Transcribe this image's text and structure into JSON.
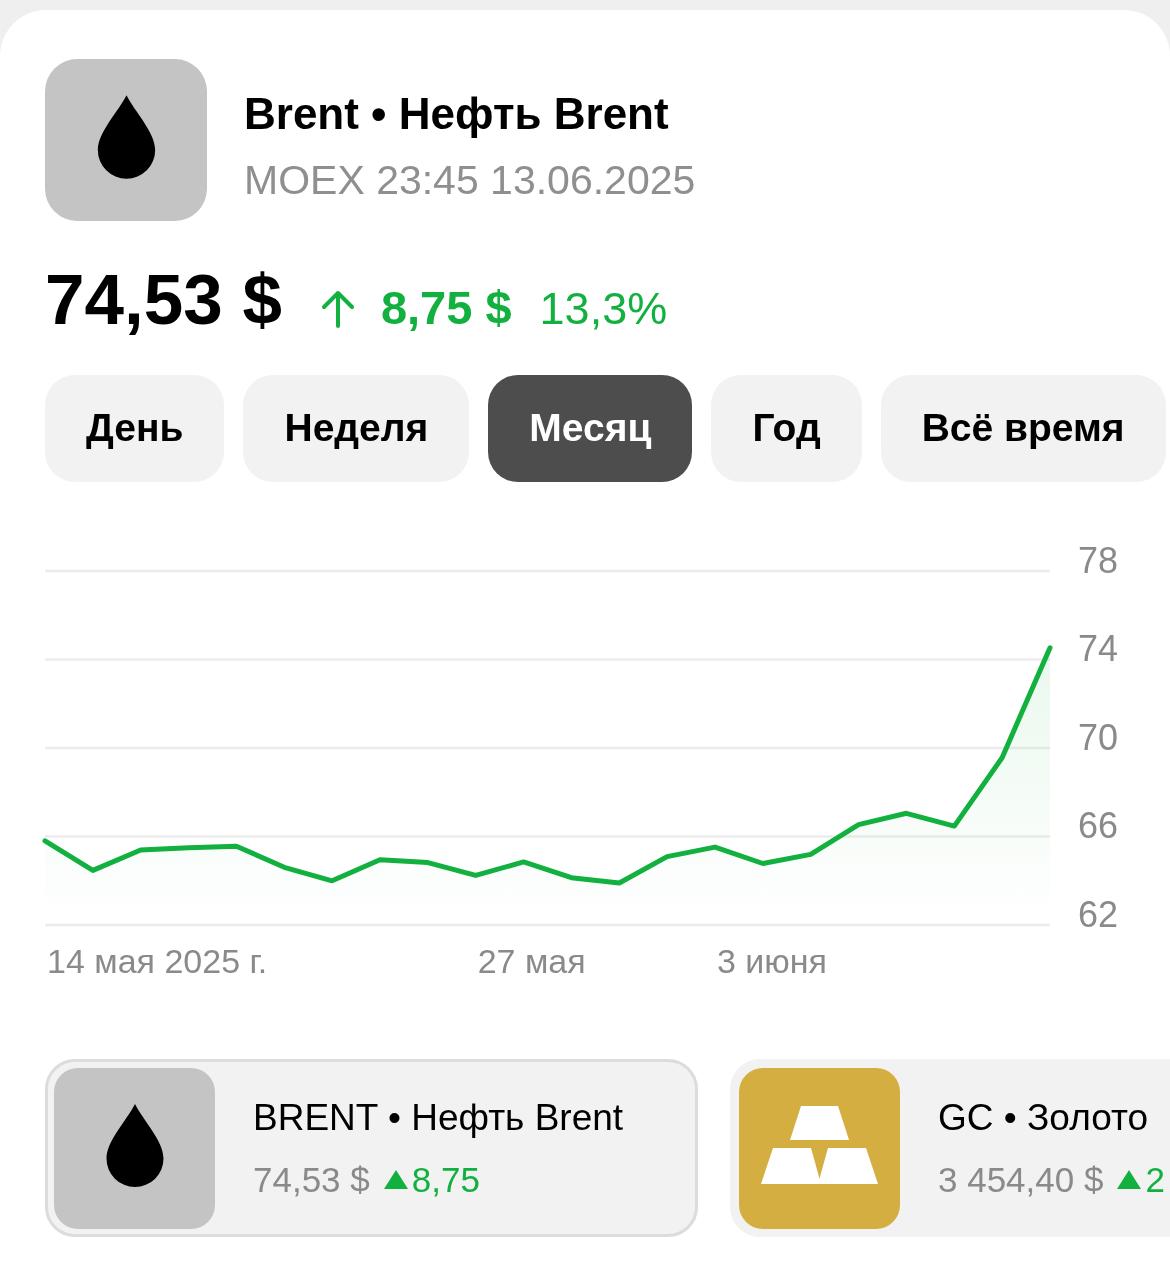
{
  "instrument": {
    "kind": "oil",
    "title": "Brent • Нефть Brent",
    "subtitle": "MOEX 23:45 13.06.2025",
    "price": "74,53 $",
    "change": {
      "rising": true,
      "amount": "8,75 $",
      "percent": "13,3%"
    }
  },
  "periods": [
    {
      "label": "День",
      "selected": false
    },
    {
      "label": "Неделя",
      "selected": false
    },
    {
      "label": "Месяц",
      "selected": true
    },
    {
      "label": "Год",
      "selected": false
    },
    {
      "label": "Всё время",
      "selected": false
    }
  ],
  "chart": {
    "chart_data": {
      "type": "area",
      "grid": true,
      "values": [
        65.8,
        64.47,
        65.39,
        65.49,
        65.56,
        64.61,
        64.0,
        64.95,
        64.82,
        64.24,
        64.85,
        64.14,
        63.9,
        65.09,
        65.52,
        64.78,
        65.19,
        66.54,
        67.05,
        66.47,
        69.56,
        74.53
      ],
      "ylim": [
        62,
        78
      ],
      "yticks": [
        62,
        66,
        70,
        74,
        78
      ]
    },
    "date_labels": [
      "14 мая 2025 г.",
      "27 мая",
      "3 июня"
    ]
  },
  "related": [
    {
      "kind": "oil",
      "selected": true,
      "title": "BRENT • Нефть Brent",
      "price": "74,53 $",
      "rising": true,
      "change": "8,75"
    },
    {
      "kind": "gold",
      "selected": false,
      "title": "GC • Золото",
      "price": "3 454,40 $",
      "rising": true,
      "change": "2"
    }
  ]
}
